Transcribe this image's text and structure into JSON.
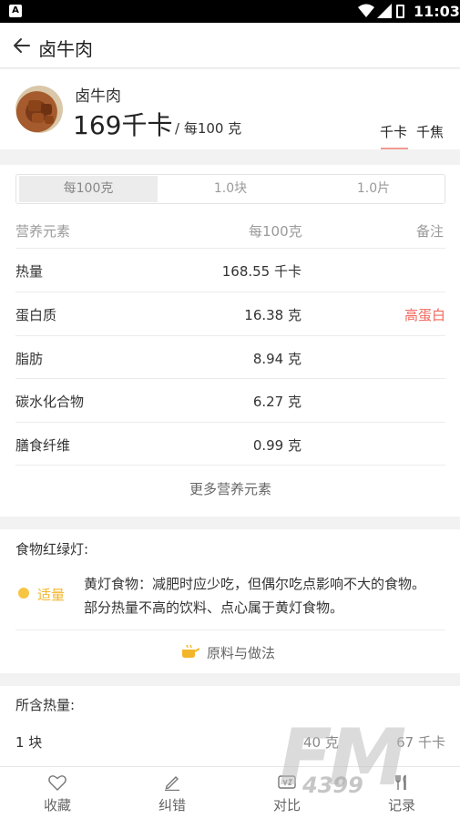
{
  "status_bar": {
    "time": "11:03",
    "left_icon": "A"
  },
  "header": {
    "title": "卤牛肉"
  },
  "food": {
    "name": "卤牛肉",
    "calories": "169千卡",
    "per": "/ 每100 克",
    "unit_options": [
      "千卡",
      "千焦"
    ],
    "selected_unit": "千卡"
  },
  "nutrition": {
    "tabs": [
      "每100克",
      "1.0块",
      "1.0片"
    ],
    "active_tab": "每100克",
    "columns": {
      "name": "营养元素",
      "per": "每100克",
      "note": "备注"
    },
    "rows": [
      {
        "name": "热量",
        "value": "168.55 千卡",
        "note": ""
      },
      {
        "name": "蛋白质",
        "value": "16.38 克",
        "note": "高蛋白"
      },
      {
        "name": "脂肪",
        "value": "8.94 克",
        "note": ""
      },
      {
        "name": "碳水化合物",
        "value": "6.27 克",
        "note": ""
      },
      {
        "name": "膳食纤维",
        "value": "0.99 克",
        "note": ""
      }
    ],
    "more_label": "更多营养元素"
  },
  "traffic_light": {
    "title": "食物红绿灯:",
    "level": "适量",
    "level_color": "#f6c543",
    "description": "黄灯食物：减肥时应少吃，但偶尔吃点影响不大的食物。部分热量不高的饮料、点心属于黄灯食物。",
    "recipe_label": "原料与做法"
  },
  "calories_section": {
    "title": "所含热量:",
    "rows": [
      {
        "name": "1 块",
        "weight": "40 克",
        "kcal": "67 千卡"
      }
    ]
  },
  "bottom_nav": [
    {
      "label": "收藏",
      "icon": "heart-icon"
    },
    {
      "label": "纠错",
      "icon": "pencil-icon"
    },
    {
      "label": "对比",
      "icon": "compare-icon"
    },
    {
      "label": "记录",
      "icon": "record-icon"
    }
  ],
  "watermark": {
    "brand": "FM",
    "number": "4399"
  },
  "colors": {
    "accent": "#f0675b",
    "underline": "#f29b92",
    "yellow": "#f6c543"
  }
}
